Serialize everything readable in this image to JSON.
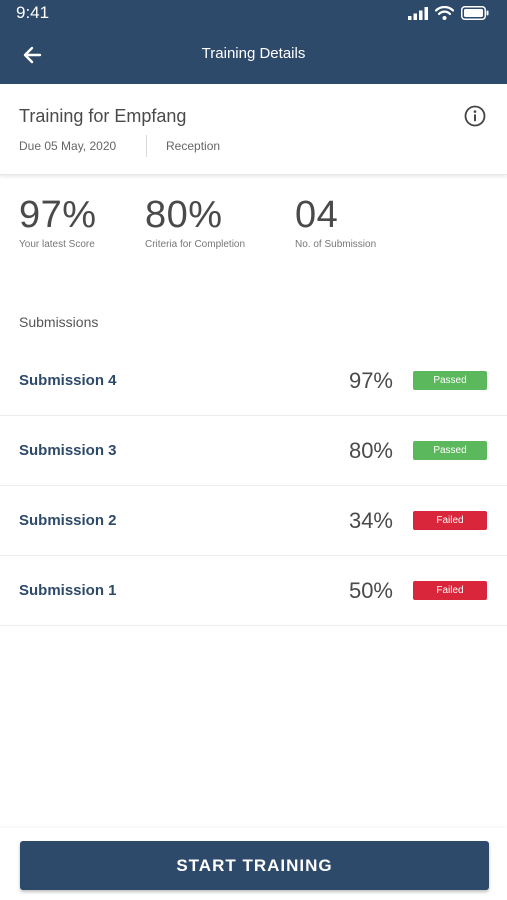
{
  "status_bar": {
    "time": "9:41",
    "icons": [
      "cellular-signal-icon",
      "wifi-icon",
      "battery-icon"
    ]
  },
  "nav": {
    "title": "Training Details",
    "back_icon": "back-arrow-icon"
  },
  "training": {
    "title": "Training for Empfang",
    "due": "Due 05 May, 2020",
    "department": "Reception",
    "info_icon": "info-icon"
  },
  "stats": [
    {
      "value": "97%",
      "label": "Your latest Score"
    },
    {
      "value": "80%",
      "label": "Criteria for Completion"
    },
    {
      "value": "04",
      "label": "No. of Submission"
    }
  ],
  "submissions_title": "Submissions",
  "submissions": [
    {
      "name": "Submission 4",
      "score": "97%",
      "status": "Passed"
    },
    {
      "name": "Submission 3",
      "score": "80%",
      "status": "Passed"
    },
    {
      "name": "Submission 2",
      "score": "34%",
      "status": "Failed"
    },
    {
      "name": "Submission 1",
      "score": "50%",
      "status": "Failed"
    }
  ],
  "colors": {
    "primary": "#2e4a6b",
    "passed": "#5cb85c",
    "failed": "#d9263a"
  },
  "start_button": "START TRAINING"
}
